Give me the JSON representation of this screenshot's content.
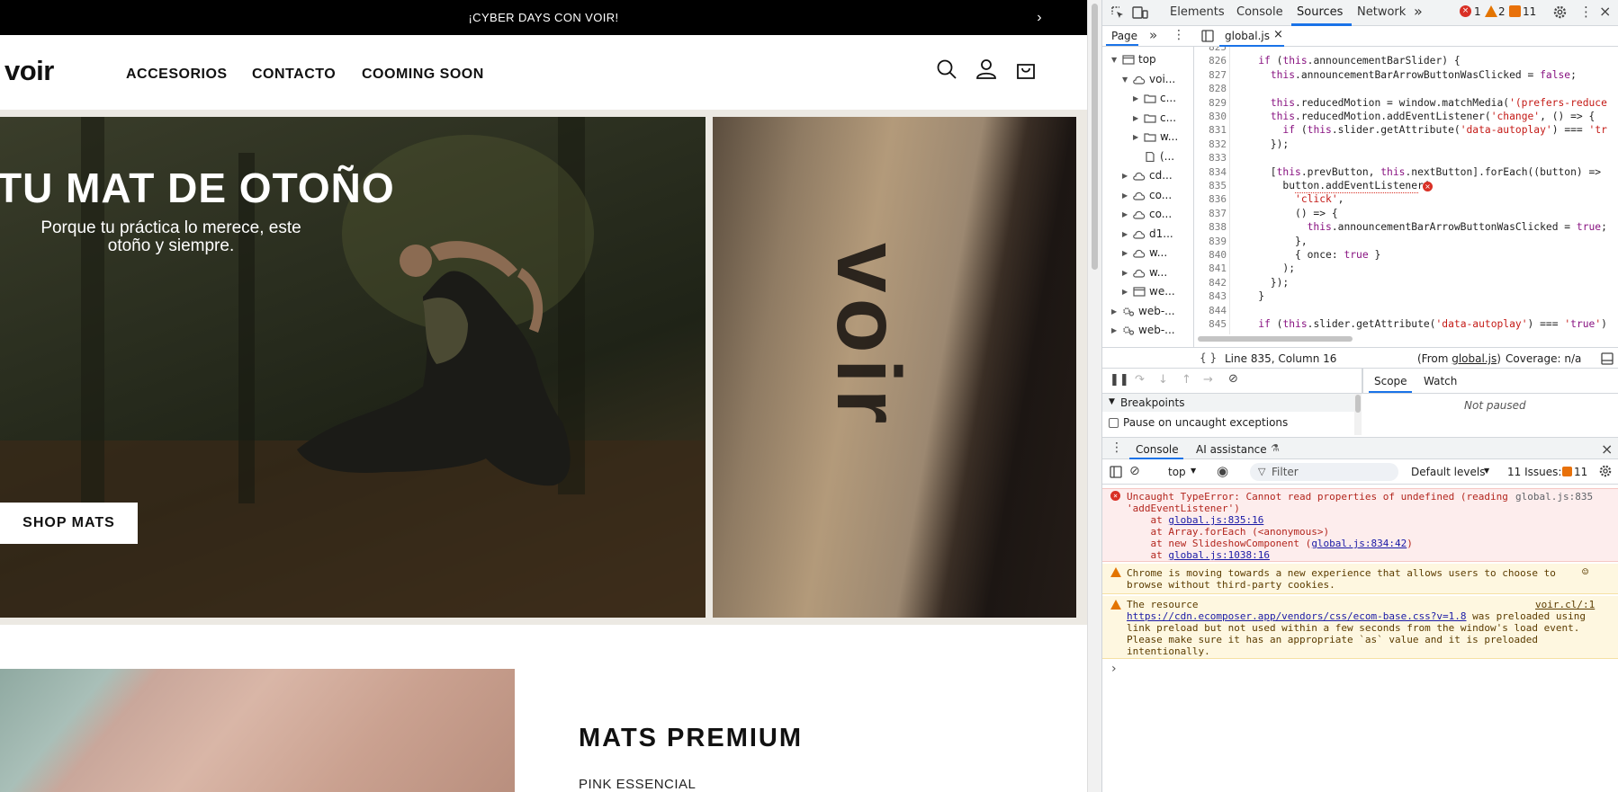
{
  "site": {
    "announcement": "¡CYBER DAYS CON VOIR!",
    "announcement_next": "›",
    "logo": "voir",
    "nav": [
      "ACCESORIOS",
      "CONTACTO",
      "COOMING SOON"
    ],
    "hero_title": "TU  MAT DE OTOÑO",
    "hero_subtitle": "Porque tu práctica lo merece, este otoño y siempre.",
    "hero_button": "SHOP MATS",
    "hero_right_brand": "voir",
    "promo_title": "MATS PREMIUM",
    "promo_subtitle": "PINK ESSENCIAL"
  },
  "devtools": {
    "tabs": [
      "Elements",
      "Console",
      "Sources",
      "Network"
    ],
    "active_tab": "Sources",
    "more": "»",
    "badges": {
      "errors": "1",
      "warnings": "2",
      "issues": "11"
    },
    "nav_tabs": {
      "page": "Page",
      "more": "»"
    },
    "file_tab": "global.js",
    "file_tab_close": "×",
    "tree": [
      {
        "label": "top",
        "indent": 0,
        "type": "frame",
        "expanded": true
      },
      {
        "label": "voi...",
        "indent": 1,
        "type": "cloud",
        "expanded": true
      },
      {
        "label": "c...",
        "indent": 2,
        "type": "folder",
        "expanded": false
      },
      {
        "label": "c...",
        "indent": 2,
        "type": "folder",
        "expanded": false
      },
      {
        "label": "w...",
        "indent": 2,
        "type": "folder",
        "expanded": false
      },
      {
        "label": "(...",
        "indent": 2,
        "type": "file",
        "expanded": null
      },
      {
        "label": "cd...",
        "indent": 1,
        "type": "cloud",
        "expanded": false
      },
      {
        "label": "co...",
        "indent": 1,
        "type": "cloud",
        "expanded": false
      },
      {
        "label": "co...",
        "indent": 1,
        "type": "cloud",
        "expanded": false
      },
      {
        "label": "d1...",
        "indent": 1,
        "type": "cloud",
        "expanded": false
      },
      {
        "label": "w...",
        "indent": 1,
        "type": "cloud",
        "expanded": false
      },
      {
        "label": "w...",
        "indent": 1,
        "type": "cloud",
        "expanded": false
      },
      {
        "label": "we...",
        "indent": 1,
        "type": "frame",
        "expanded": false
      },
      {
        "label": "web-...",
        "indent": 0,
        "type": "gear",
        "expanded": false
      },
      {
        "label": "web-...",
        "indent": 0,
        "type": "gear",
        "expanded": false
      }
    ],
    "code": [
      {
        "n": "825",
        "t": ""
      },
      {
        "n": "826",
        "t": "    if (this.announcementBarSlider) {"
      },
      {
        "n": "827",
        "t": "      this.announcementBarArrowButtonWasClicked = false;"
      },
      {
        "n": "828",
        "t": ""
      },
      {
        "n": "829",
        "t": "      this.reducedMotion = window.matchMedia('(prefers-reduce"
      },
      {
        "n": "830",
        "t": "      this.reducedMotion.addEventListener('change', () => {"
      },
      {
        "n": "831",
        "t": "        if (this.slider.getAttribute('data-autoplay') === 'tr"
      },
      {
        "n": "832",
        "t": "      });"
      },
      {
        "n": "833",
        "t": ""
      },
      {
        "n": "834",
        "t": "      [this.prevButton, this.nextButton].forEach((button) =>"
      },
      {
        "n": "835",
        "t": "        button.addEventListener("
      },
      {
        "n": "836",
        "t": "          'click',"
      },
      {
        "n": "837",
        "t": "          () => {"
      },
      {
        "n": "838",
        "t": "            this.announcementBarArrowButtonWasClicked = true;"
      },
      {
        "n": "839",
        "t": "          },"
      },
      {
        "n": "840",
        "t": "          { once: true }"
      },
      {
        "n": "841",
        "t": "        );"
      },
      {
        "n": "842",
        "t": "      });"
      },
      {
        "n": "843",
        "t": "    }"
      },
      {
        "n": "844",
        "t": ""
      },
      {
        "n": "845",
        "t": "    if (this.slider.getAttribute('data-autoplay') === 'true')"
      }
    ],
    "status": {
      "position": "Line 835, Column 16",
      "from_prefix": "(From ",
      "from_file": "global.js",
      "from_suffix": ")",
      "coverage": "Coverage: n/a"
    },
    "debugger": {
      "scope_tab": "Scope",
      "watch_tab": "Watch",
      "not_paused": "Not paused",
      "breakpoints": "Breakpoints",
      "pause_uncaught": "Pause on uncaught exceptions"
    },
    "drawer": {
      "console_tab": "Console",
      "ai_tab": "AI assistance",
      "context": "top",
      "filter_placeholder": "Filter",
      "levels": "Default levels",
      "issues_label": "11 Issues:",
      "issues_count": "11"
    },
    "messages": {
      "error": {
        "text1": "Uncaught TypeError: Cannot read properties of undefined (reading",
        "text2": "'addEventListener')",
        "source": "global.js:835",
        "stack": [
          {
            "prefix": "    at ",
            "link": "global.js:835:16",
            "suffix": ""
          },
          {
            "prefix": "    at Array.forEach (<anonymous>)",
            "link": "",
            "suffix": ""
          },
          {
            "prefix": "    at new SlideshowComponent (",
            "link": "global.js:834:42",
            "suffix": ")"
          },
          {
            "prefix": "    at ",
            "link": "global.js:1038:16",
            "suffix": ""
          }
        ]
      },
      "warn1": {
        "line1": "Chrome is moving towards a new experience that allows users to choose to",
        "line2": "browse without third-party cookies."
      },
      "warn2": {
        "line1": "The resource",
        "source": "voir.cl/:1",
        "url": "https://cdn.ecomposer.app/vendors/css/ecom-base.css?v=1.8",
        "line2_suffix": " was preloaded using",
        "line3": "link preload but not used within a few seconds from the window's load event.",
        "line4": "Please make sure it has an appropriate `as` value and it is preloaded",
        "line5": "intentionally."
      },
      "prompt": "›"
    }
  },
  "colors": {
    "error_red": "#d93025",
    "warning_orange": "#e37400",
    "active_blue": "#1a73e8"
  }
}
